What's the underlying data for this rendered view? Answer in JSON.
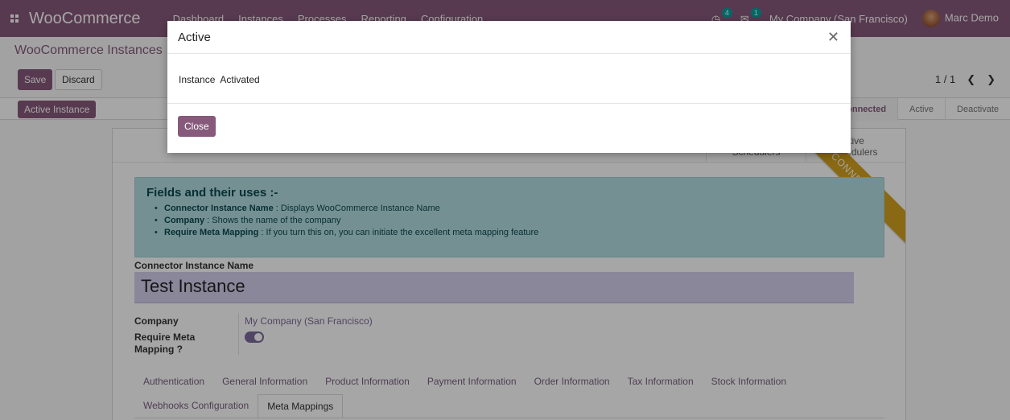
{
  "navbar": {
    "brand": "WooCommerce",
    "menu": [
      "Dashboard",
      "Instances",
      "Processes",
      "Reporting",
      "Configuration"
    ],
    "activity_count": "4",
    "message_count": "1",
    "company": "My Company (San Francisco)",
    "user": "Marc Demo"
  },
  "control": {
    "breadcrumb": "WooCommerce Instances",
    "save_label": "Save",
    "discard_label": "Discard",
    "pager": "1 / 1",
    "active_instance_label": "Active Instance",
    "stages": [
      "Connected",
      "Active",
      "Deactivate"
    ]
  },
  "sheet": {
    "smart_buttons": [
      "Schedulers",
      "tive\nchedulers"
    ],
    "ribbon": "CONNECTED",
    "info": {
      "title": "Fields and their uses :-",
      "items": [
        {
          "name": "Connector Instance Name",
          "desc": " : Displays WooCommerce Instance Name"
        },
        {
          "name": "Company",
          "desc": " : Shows the name of the company"
        },
        {
          "name": "Require Meta Mapping",
          "desc": " : If you turn this on, you can initiate the excellent meta mapping feature"
        }
      ]
    },
    "instance_label": "Connector Instance Name",
    "instance_value": "Test Instance",
    "company_label": "Company",
    "company_value": "My Company (San Francisco)",
    "meta_label": "Require Meta Mapping ?",
    "tabs_row1": [
      "Authentication",
      "General Information",
      "Product Information",
      "Payment Information",
      "Order Information",
      "Tax Information",
      "Stock Information"
    ],
    "tabs_row2": [
      "Webhooks Configuration",
      "Meta Mappings"
    ]
  },
  "modal": {
    "title": "Active",
    "close_icon": "close-icon",
    "message": "Instance  Activated",
    "close_label": "Close"
  },
  "colors": {
    "primary": "#875a7b",
    "info": "#b2dde0",
    "ribbon": "#d4a11f"
  }
}
